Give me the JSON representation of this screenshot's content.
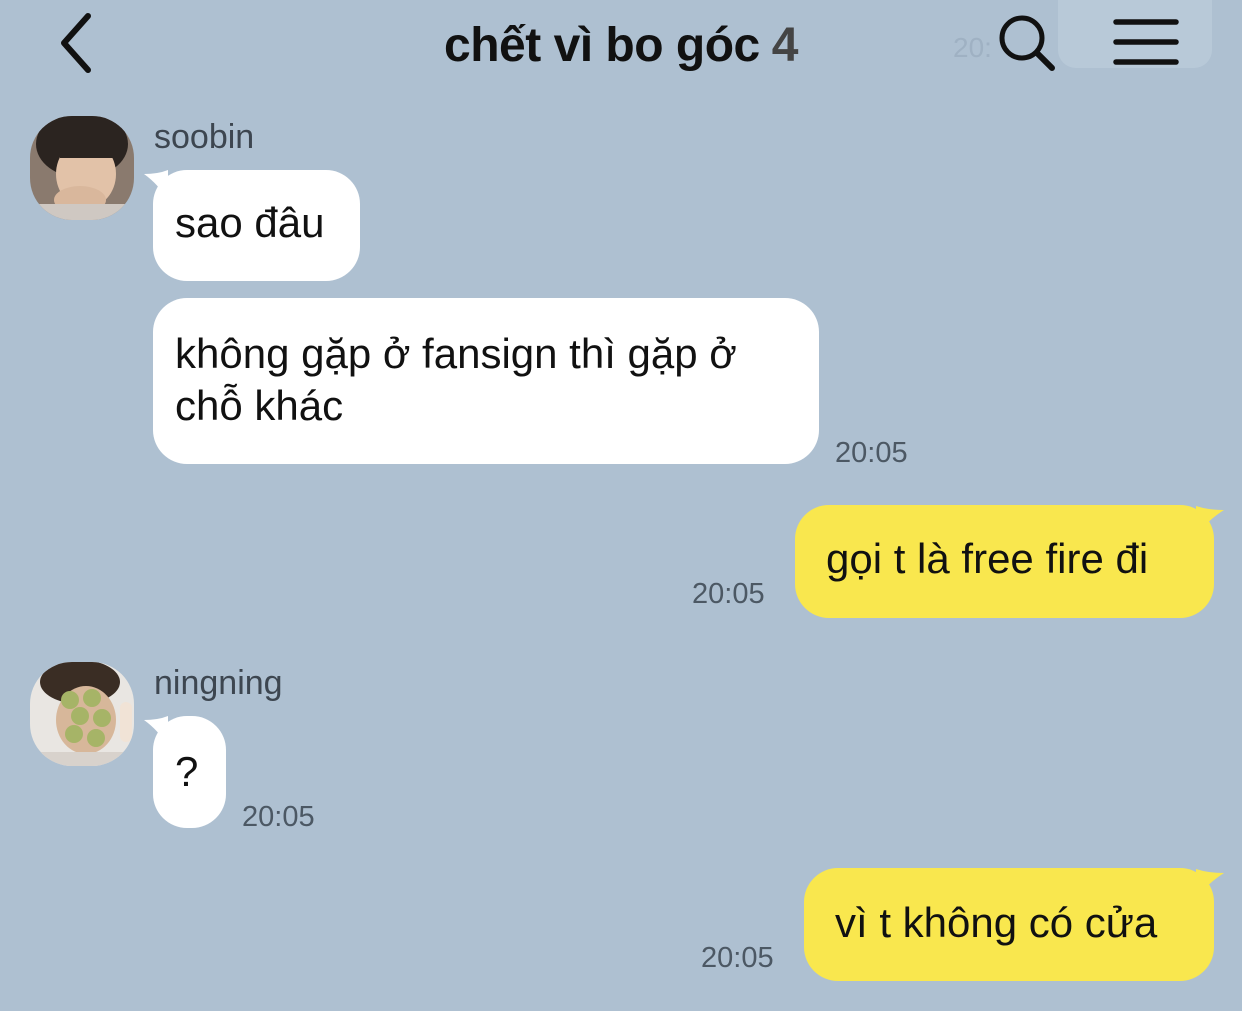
{
  "header": {
    "title": "chết vì bo góc",
    "member_count": "4",
    "ghost_time": "20:"
  },
  "messages": [
    {
      "sender": "soobin",
      "text": "sao đâu"
    },
    {
      "text": "không gặp ở fansign thì gặp ở chỗ khác",
      "time": "20:05"
    },
    {
      "text": "gọi t là free fire đi",
      "time": "20:05"
    },
    {
      "sender": "ningning",
      "text": "?",
      "time": "20:05"
    },
    {
      "text": "vì t không có cửa",
      "time": "20:05"
    }
  ],
  "colors": {
    "background": "#aec0d1",
    "incoming_bubble": "#ffffff",
    "outgoing_bubble": "#f9e74e"
  },
  "icons": [
    "back-chevron-icon",
    "search-icon",
    "menu-icon"
  ]
}
